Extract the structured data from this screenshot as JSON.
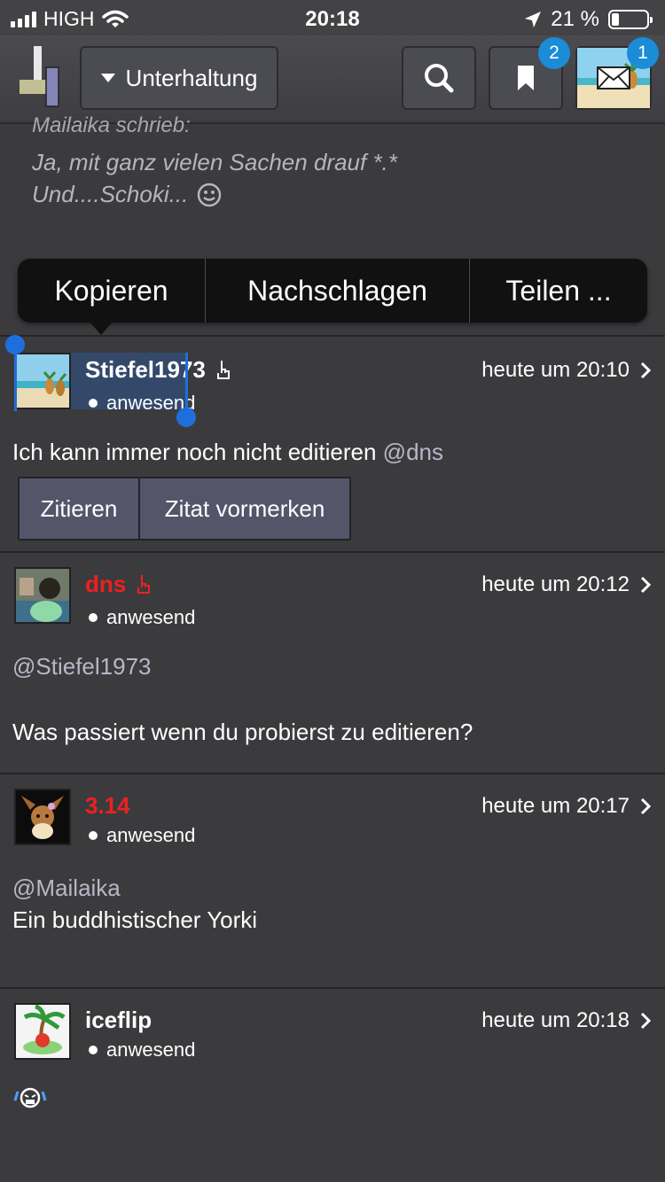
{
  "status_bar": {
    "carrier": "HIGH",
    "time": "20:18",
    "battery": "21 %",
    "battery_level": 0.21
  },
  "header": {
    "forum_select": "Unterhaltung",
    "bookmarks_badge": "2",
    "messages_badge": "1"
  },
  "quote": {
    "author": "Mailaika schrieb:",
    "line1": "Ja, mit ganz vielen Sachen drauf *.*",
    "line2": "Und....Schoki..."
  },
  "context_menu": {
    "copy": "Kopieren",
    "lookup": "Nachschlagen",
    "share": "Teilen ..."
  },
  "posts": [
    {
      "author": "Stiefel1973",
      "status": "anwesend",
      "time": "heute um 20:10",
      "text": "Ich kann immer noch nicht editieren",
      "mention": "@dns",
      "quote_button": "Zitieren",
      "mark_quote_button": "Zitat vormerken"
    },
    {
      "author": "dns",
      "status": "anwesend",
      "time": "heute um 20:12",
      "mention": "@Stiefel1973",
      "text": "Was passiert wenn du probierst zu editieren?"
    },
    {
      "author": "3.14",
      "status": "anwesend",
      "time": "heute um 20:17",
      "mention": "@Mailaika",
      "text": "Ein buddhistischer Yorki"
    },
    {
      "author": "iceflip",
      "status": "anwesend",
      "time": "heute um 20:18"
    }
  ],
  "colors": {
    "background": "#3b3b3e",
    "header": "#4b4b4f",
    "mod_name": "#ee2020",
    "badge": "#1a8cd8",
    "selection": "#1e6fdc"
  }
}
